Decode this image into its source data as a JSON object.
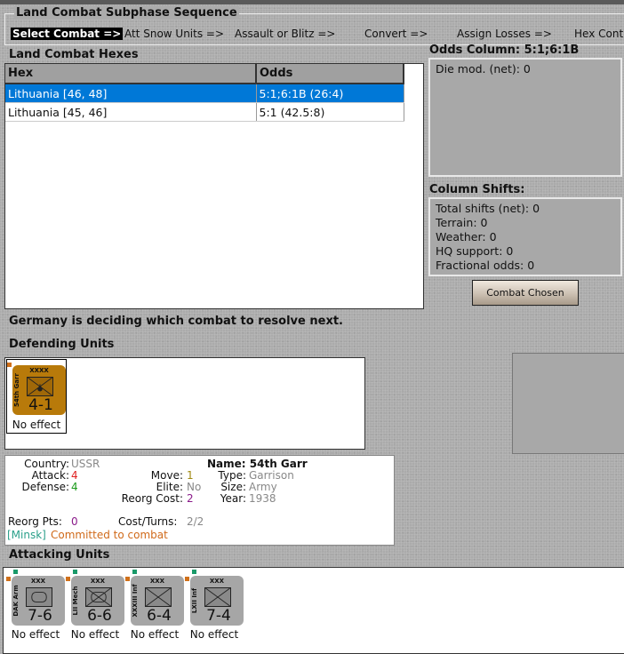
{
  "sequence": {
    "title": "Land Combat Subphase Sequence",
    "steps": [
      "Select Combat =>",
      "Att Snow Units =>",
      "Assault or Blitz =>",
      "Convert =>",
      "Assign Losses =>",
      "Hex Cont"
    ]
  },
  "hexes": {
    "title": "Land Combat Hexes",
    "columns": [
      "Hex",
      "Odds"
    ],
    "rows": [
      {
        "hex": "Lithuania [46, 48]",
        "odds": "5:1;6:1B (26:4)"
      },
      {
        "hex": "Lithuania [45, 46]",
        "odds": "5:1 (42.5:8)"
      }
    ]
  },
  "odds": {
    "title": "Odds Column: 5:1;6:1B",
    "die_mod": "Die mod. (net): 0"
  },
  "shifts": {
    "title": "Column Shifts:",
    "items": [
      "Total shifts (net): 0",
      "Terrain: 0",
      "Weather: 0",
      "HQ support: 0",
      "Fractional odds: 0"
    ]
  },
  "button": "Combat Chosen",
  "status": "Germany is deciding which combat to resolve next.",
  "defending": {
    "title": "Defending Units",
    "units": [
      {
        "size": "XXXX",
        "name": "54th Garr",
        "strength": "4-1",
        "result": "No effect"
      }
    ]
  },
  "info": {
    "country_l": "Country:",
    "country": "USSR",
    "attack_l": "Attack:",
    "attack": "4",
    "defense_l": "Defense:",
    "defense": "4",
    "move_l": "Move:",
    "move": "1",
    "elite_l": "Elite:",
    "elite": "No",
    "reorg_cost_l": "Reorg Cost:",
    "reorg_cost": "2",
    "name": "Name: 54th Garr",
    "type_l": "Type:",
    "type": "Garrison",
    "size_l": "Size:",
    "size": "Army",
    "year_l": "Year:",
    "year": "1938",
    "reorg_pts_l": "Reorg Pts:",
    "reorg_pts": "0",
    "cost_turns_l": "Cost/Turns:",
    "cost_turns": "2/2",
    "location": "[Minsk]",
    "state": "Committed to combat"
  },
  "attacking": {
    "title": "Attacking Units",
    "units": [
      {
        "size": "XXX",
        "name": "DAK Arm",
        "strength": "7-6",
        "result": "No effect",
        "type": "armor"
      },
      {
        "size": "XXX",
        "name": "LII Mech",
        "strength": "6-6",
        "result": "No effect",
        "type": "mech"
      },
      {
        "size": "XXX",
        "name": "XXXIII Inf",
        "strength": "6-4",
        "result": "No effect",
        "type": "inf"
      },
      {
        "size": "XXX",
        "name": "LXII Inf",
        "strength": "7-4",
        "result": "No effect",
        "type": "inf"
      }
    ]
  },
  "colors": {
    "selected": "#0078d7",
    "defender": "#b87a0a",
    "attacker": "#a6a6a6"
  }
}
